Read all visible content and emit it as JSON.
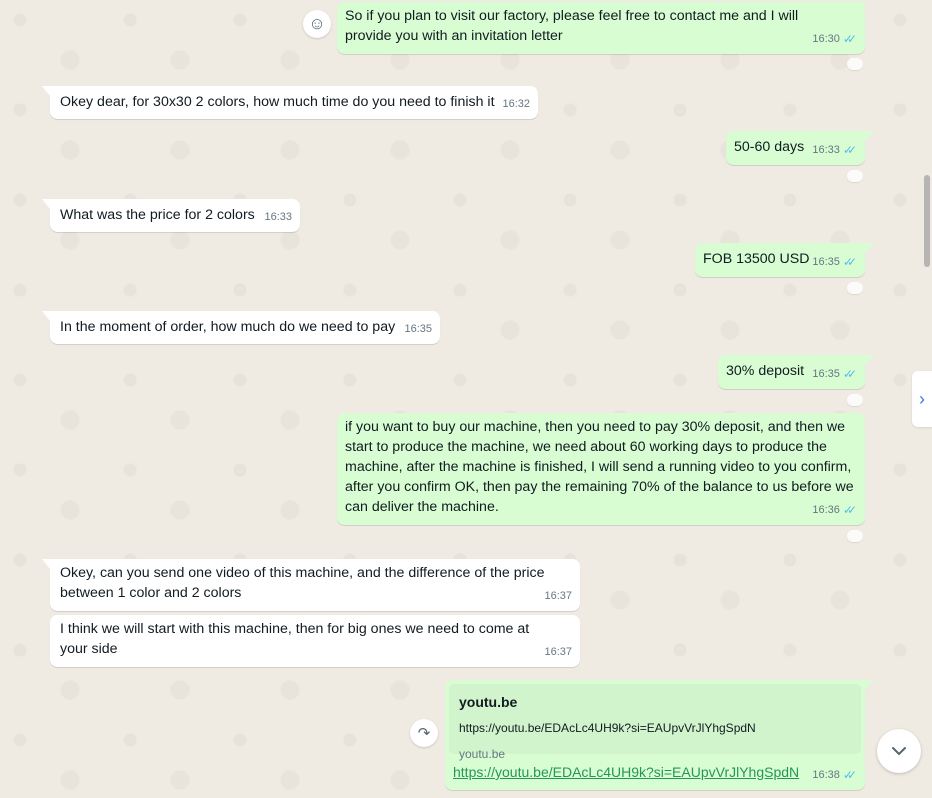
{
  "messages": [
    {
      "text": "So if you plan to visit our factory, please feel free to contact me and I will provide you with an invitation letter",
      "time": "16:30"
    },
    {
      "text": "Okey dear, for 30x30 2 colors, how much time do you need to finish it",
      "time": "16:32"
    },
    {
      "text": "50-60 days",
      "time": "16:33"
    },
    {
      "text": "What was the price for 2 colors",
      "time": "16:33"
    },
    {
      "text": "FOB 13500 USD",
      "time": "16:35"
    },
    {
      "text": "In the moment of order, how much do we need to pay",
      "time": "16:35"
    },
    {
      "text": "30% deposit",
      "time": "16:35"
    },
    {
      "text": "if you want to buy our machine, then you need to pay 30% deposit, and then we start to produce the machine, we need about 60 working days to produce the machine, after the machine is finished, I will send a running video to you confirm, after you confirm OK, then pay the remaining 70% of the balance to us before we can deliver the machine.",
      "time": "16:36"
    },
    {
      "text": "Okey, can you send one video of this machine, and the difference of the price between 1 color and 2 colors",
      "time": "16:37"
    },
    {
      "text": "I think we will start with this machine, then for big ones we need to come at your side",
      "time": "16:37"
    },
    {
      "link_title": "youtu.be",
      "link_url": "https://youtu.be/EDAcLc4UH9k?si=EAUpvVrJlYhgSpdN",
      "link_domain": "youtu.be",
      "text": "https://youtu.be/EDAcLc4UH9k?si=EAUpvVrJlYhgSpdN",
      "time": "16:38"
    }
  ],
  "icons": {
    "emoji": "☺",
    "forward": "↷",
    "side": "›",
    "down": "⌄",
    "read_ticks": "✓✓"
  }
}
